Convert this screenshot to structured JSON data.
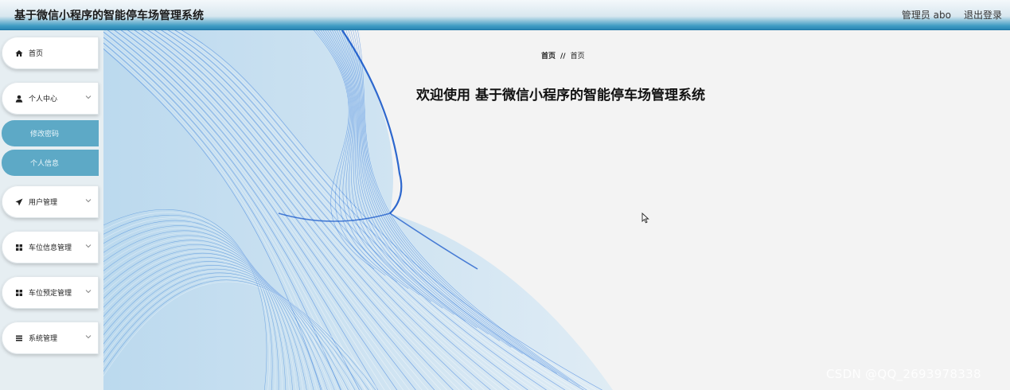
{
  "header": {
    "title": "基于微信小程序的智能停车场管理系统",
    "admin_label": "管理员 abo",
    "logout_label": "退出登录"
  },
  "sidebar": {
    "items": [
      {
        "label": "首页",
        "icon": "home-icon"
      },
      {
        "label": "个人中心",
        "icon": "user-icon"
      },
      {
        "label": "用户管理",
        "icon": "send-icon"
      },
      {
        "label": "车位信息管理",
        "icon": "grid-icon"
      },
      {
        "label": "车位预定管理",
        "icon": "grid-icon"
      },
      {
        "label": "系统管理",
        "icon": "list-icon"
      }
    ],
    "subitems": [
      {
        "label": "修改密码"
      },
      {
        "label": "个人信息"
      }
    ]
  },
  "main": {
    "breadcrumb": [
      "首页",
      "首页"
    ],
    "breadcrumb_sep": "//",
    "welcome_prefix": "欢迎使用",
    "welcome_title": "基于微信小程序的智能停车场管理系统"
  },
  "watermark": "CSDN @QQ_2693978338",
  "colors": {
    "header_accent": "#2a86b3",
    "submenu_bg": "#5da9c6",
    "wave_blue": "#1565d8"
  }
}
